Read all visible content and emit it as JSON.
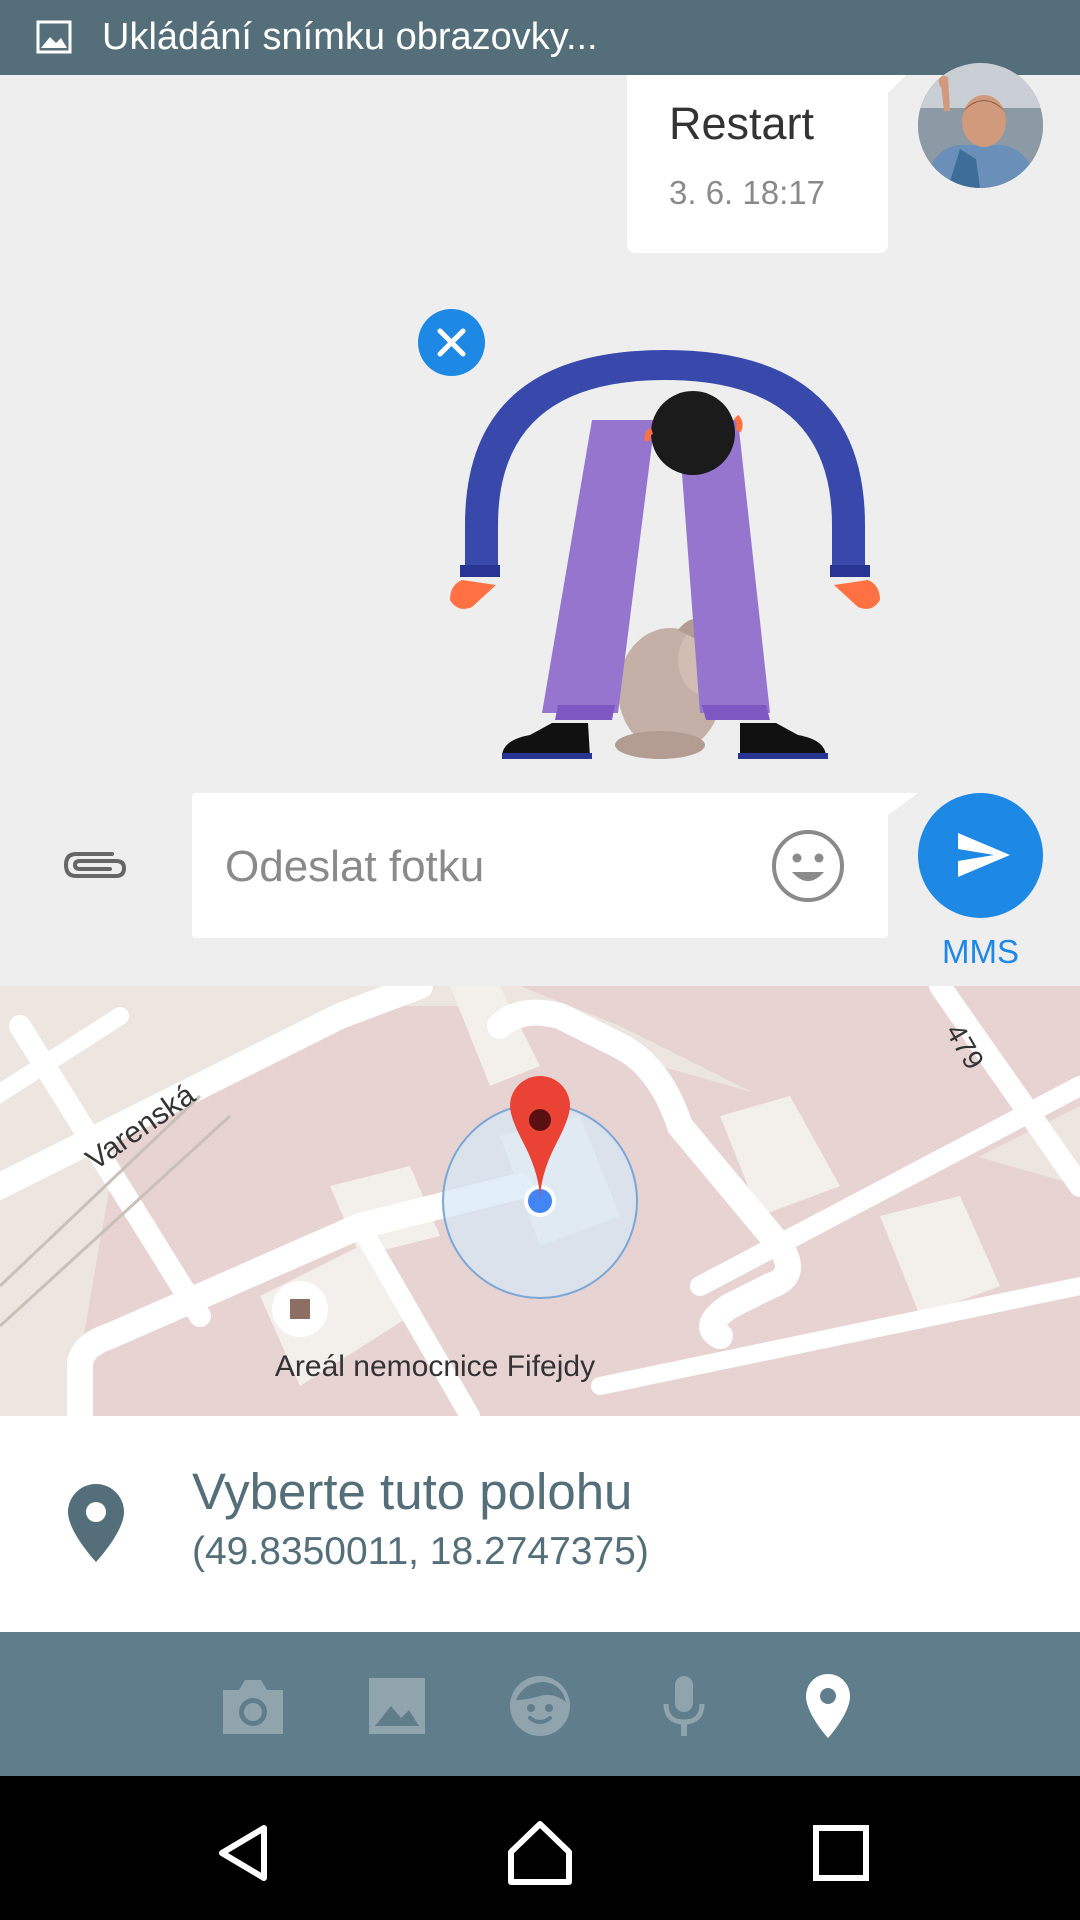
{
  "status_bar": {
    "text": "Ukládání snímku obrazovky..."
  },
  "conversation": {
    "message": {
      "text": "Restart",
      "time": "3. 6. 18:17"
    }
  },
  "compose": {
    "placeholder": "Odeslat fotku",
    "send_label": "MMS"
  },
  "map": {
    "street_label": "Varenská",
    "road_number": "479",
    "place_name": "Areál nemocnice Fifejdy"
  },
  "location": {
    "title": "Vyberte tuto polohu",
    "coordinates": "(49.8350011, 18.2747375)"
  },
  "media_toolbar": {
    "items": [
      "camera-icon",
      "gallery-icon",
      "sticker-icon",
      "microphone-icon",
      "location-icon"
    ],
    "selected": "location-icon"
  },
  "colors": {
    "accent": "#1e88e5",
    "toolbar": "#607d8b",
    "status_bar": "#546e7a",
    "map_marker": "#ea4335"
  }
}
